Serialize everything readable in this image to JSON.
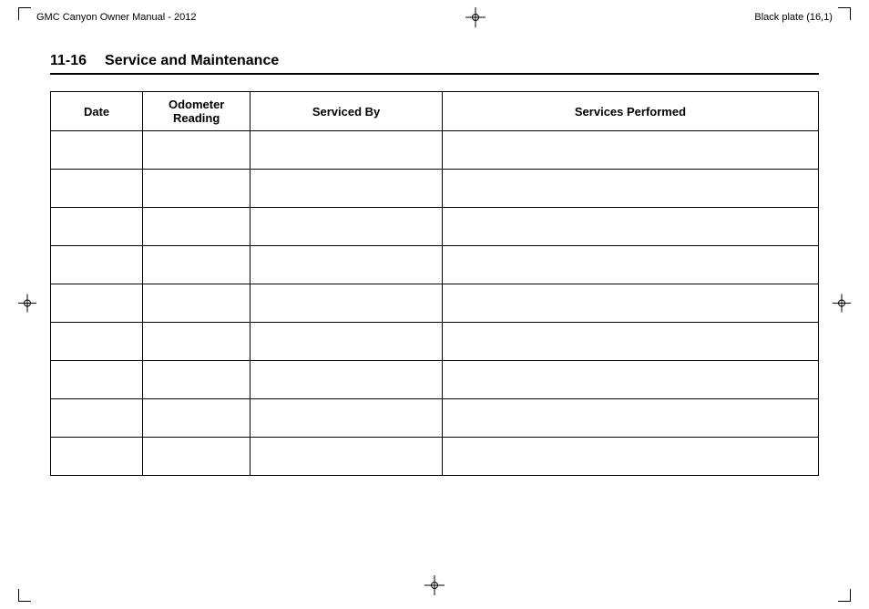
{
  "header": {
    "left_text": "GMC Canyon Owner Manual - 2012",
    "right_text": "Black plate (16,1)"
  },
  "section": {
    "number": "11-16",
    "title": "Service and Maintenance"
  },
  "table": {
    "columns": [
      {
        "id": "date",
        "label": "Date"
      },
      {
        "id": "odometer",
        "label": "Odometer\nReading"
      },
      {
        "id": "serviced_by",
        "label": "Serviced By"
      },
      {
        "id": "services_performed",
        "label": "Services Performed"
      }
    ],
    "row_count": 9
  }
}
